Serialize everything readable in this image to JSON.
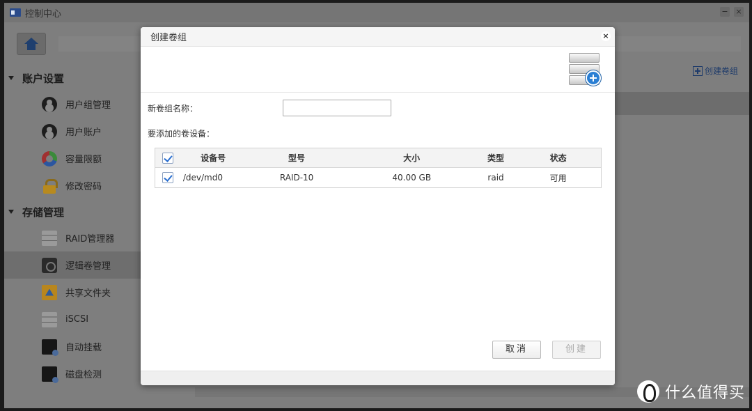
{
  "window": {
    "title": "控制中心",
    "minimize": "−",
    "close": "×"
  },
  "sidebar": {
    "sections": [
      {
        "title": "账户设置",
        "items": [
          {
            "label": "用户组管理",
            "icon": "user-group-icon"
          },
          {
            "label": "用户账户",
            "icon": "user-icon"
          },
          {
            "label": "容量限额",
            "icon": "quota-icon"
          },
          {
            "label": "修改密码",
            "icon": "lock-icon"
          }
        ]
      },
      {
        "title": "存储管理",
        "items": [
          {
            "label": "RAID管理器",
            "icon": "raid-icon"
          },
          {
            "label": "逻辑卷管理",
            "icon": "lvm-icon",
            "active": true
          },
          {
            "label": "共享文件夹",
            "icon": "shared-folder-icon"
          },
          {
            "label": "iSCSI",
            "icon": "iscsi-icon"
          },
          {
            "label": "自动挂载",
            "icon": "automount-icon"
          },
          {
            "label": "磁盘检测",
            "icon": "disk-check-icon"
          }
        ]
      }
    ]
  },
  "content": {
    "create_link": "创建卷组"
  },
  "dialog": {
    "title": "创建卷组",
    "close": "×",
    "name_label": "新卷组名称：",
    "name_value": "",
    "devices_label": "要添加的卷设备：",
    "table": {
      "headers": {
        "device": "设备号",
        "model": "型号",
        "size": "大小",
        "type": "类型",
        "status": "状态"
      },
      "rows": [
        {
          "device": "/dev/md0",
          "model": "RAID-10",
          "size": "40.00 GB",
          "type": "raid",
          "status": "可用",
          "checked": true
        }
      ]
    },
    "cancel": "取消",
    "create": "创建"
  },
  "watermark": {
    "text": "什么值得买"
  },
  "colors": {
    "accent": "#2a7fd4",
    "link": "#1d3a6a",
    "background_dim": "#7e7e7e"
  }
}
